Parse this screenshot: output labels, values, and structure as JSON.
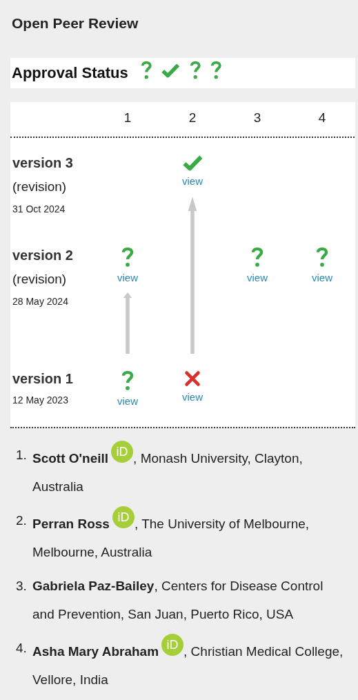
{
  "title": "Open Peer Review",
  "approval_status": {
    "label": "Approval Status",
    "icons": [
      {
        "kind": "question"
      },
      {
        "kind": "check"
      },
      {
        "kind": "question"
      },
      {
        "kind": "question"
      }
    ]
  },
  "table": {
    "columns": [
      "1",
      "2",
      "3",
      "4"
    ],
    "versions": [
      {
        "label": "version 3",
        "note": "(revision)",
        "date": "31 Oct 2024",
        "reports": [
          {
            "kind": "empty"
          },
          {
            "kind": "check",
            "link": "view",
            "arrow": true
          },
          {
            "kind": "empty"
          },
          {
            "kind": "empty"
          }
        ]
      },
      {
        "label": "version 2",
        "note": "(revision)",
        "date": "28 May 2024",
        "reports": [
          {
            "kind": "question",
            "link": "view",
            "arrow": true
          },
          {
            "kind": "empty"
          },
          {
            "kind": "question",
            "link": "view",
            "arrow": false
          },
          {
            "kind": "question",
            "link": "view",
            "arrow": false
          }
        ]
      },
      {
        "label": "version 1",
        "date": "12 May 2023",
        "reports": [
          {
            "kind": "question",
            "link": "view",
            "arrow": false
          },
          {
            "kind": "cross",
            "link": "view",
            "arrow": false
          },
          {
            "kind": "empty"
          },
          {
            "kind": "empty"
          }
        ]
      }
    ]
  },
  "reviewers": [
    {
      "number": "1.",
      "name": "Scott O'neill",
      "orcid": "iD",
      "affiliation": ", Monash University, Clayton, Australia"
    },
    {
      "number": "2.",
      "name": "Perran Ross",
      "orcid": "iD",
      "affiliation": ", The University of Melbourne, Melbourne, Australia"
    },
    {
      "number": "3.",
      "name": "Gabriela Paz-Bailey",
      "affiliation": ", Centers for Disease Control and Prevention, San Juan, Puerto Rico, USA"
    },
    {
      "number": "4.",
      "name": "Asha Mary Abraham",
      "orcid": "iD",
      "affiliation": ", Christian Medical College, Vellore, India"
    }
  ]
}
